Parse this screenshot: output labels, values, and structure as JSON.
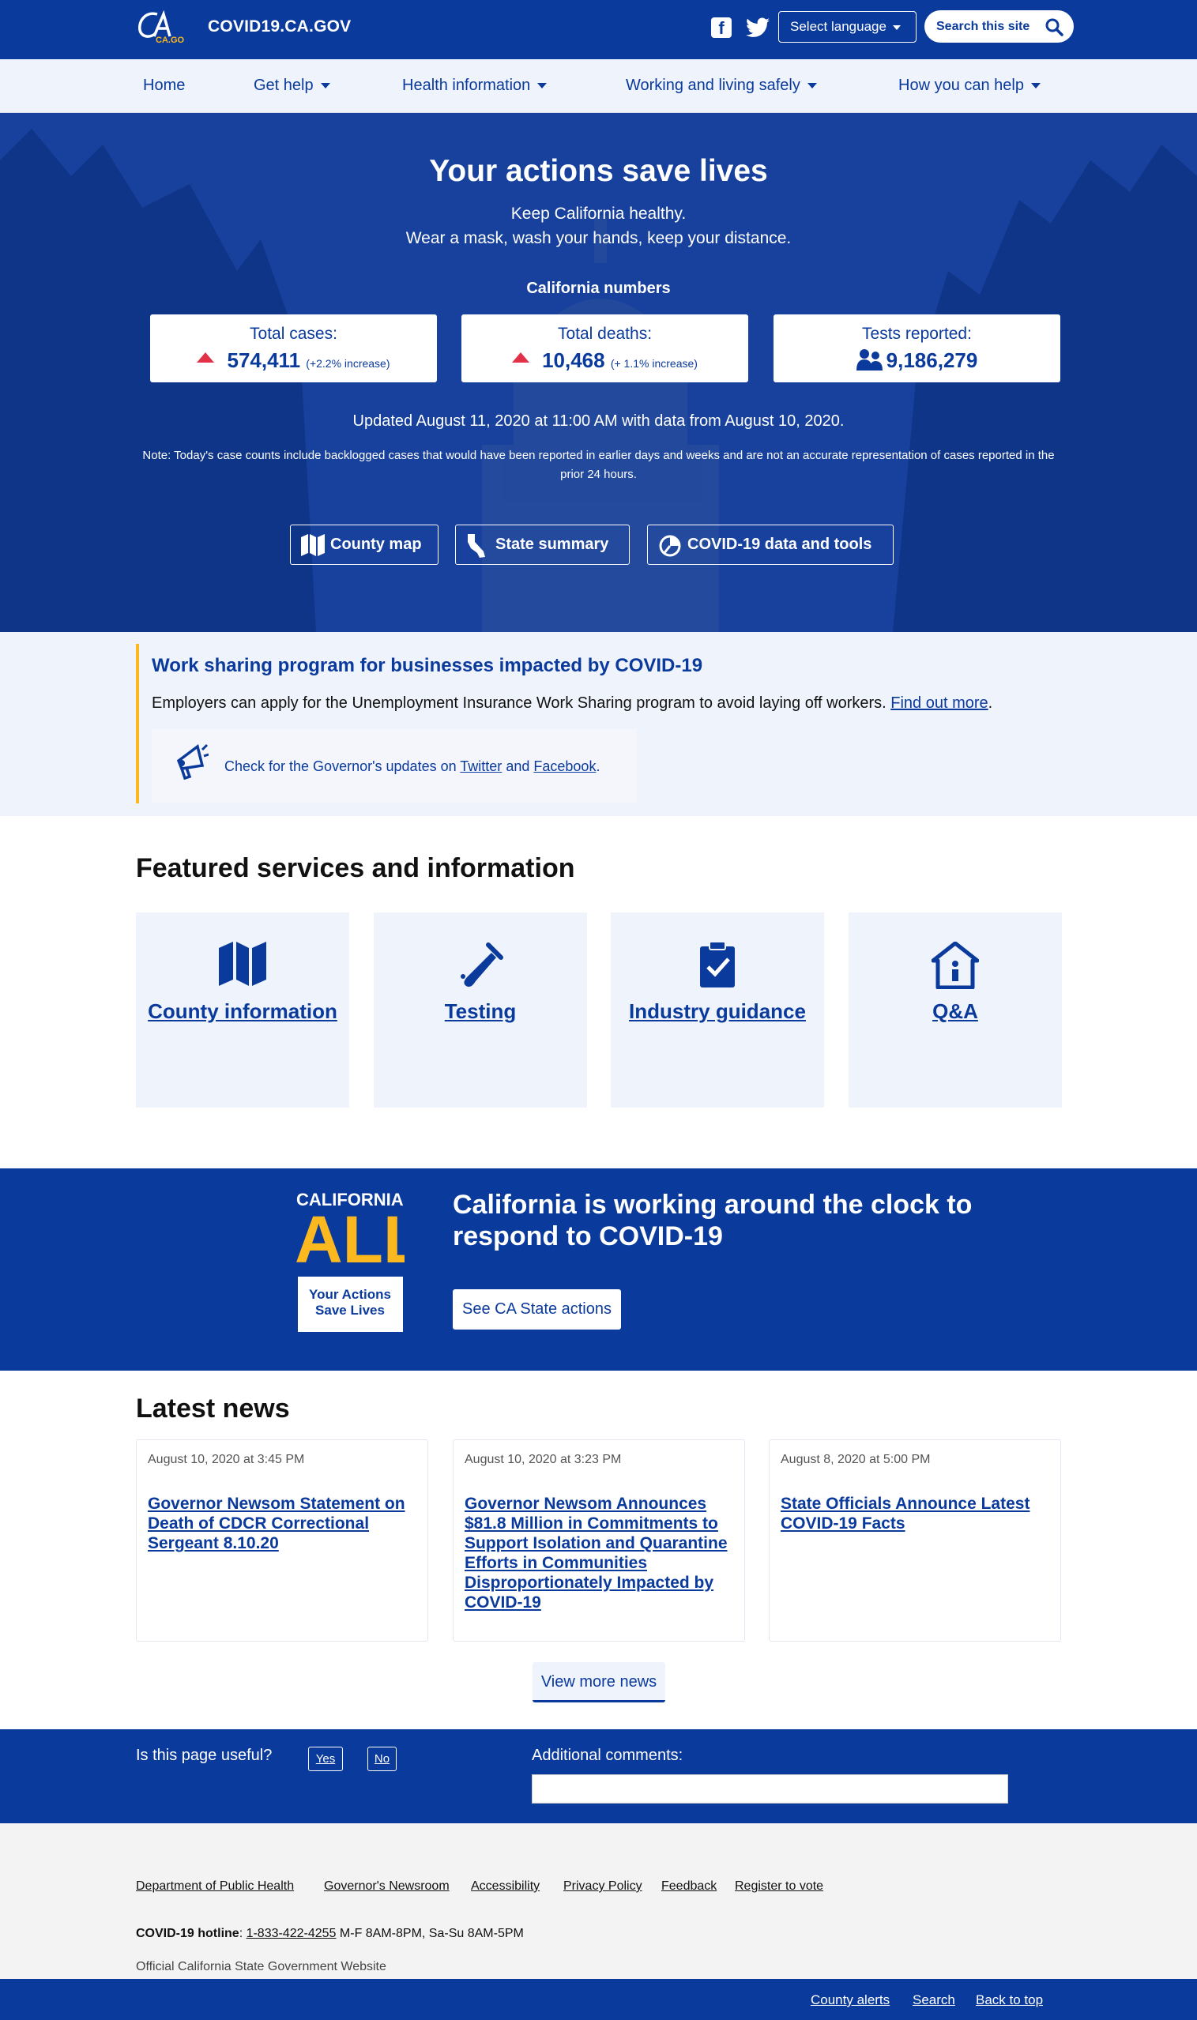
{
  "header": {
    "logo_text": "CA.GOV",
    "site_title": "COVID19.CA.GOV",
    "language_label": "Select language",
    "search_label": "Search this site"
  },
  "nav": {
    "items": [
      {
        "label": "Home"
      },
      {
        "label": "Get help"
      },
      {
        "label": "Health information"
      },
      {
        "label": "Working and living safely"
      },
      {
        "label": "How you can help"
      }
    ]
  },
  "hero": {
    "title": "Your actions save lives",
    "sub1": "Keep California healthy.",
    "sub2": "Wear a mask, wash your hands, keep your distance.",
    "numbers_heading": "California numbers",
    "stats": [
      {
        "label": "Total cases:",
        "value": "574,411",
        "change": "(+2.2% increase)"
      },
      {
        "label": "Total deaths:",
        "value": "10,468",
        "change": "(+ 1.1% increase)"
      },
      {
        "label": "Tests reported:",
        "value": "9,186,279"
      }
    ],
    "updated": "Updated August 11, 2020 at 11:00 AM with data from August 10, 2020.",
    "note": "Note: Today's case counts include backlogged cases that would have been reported in earlier days and weeks and are not an accurate representation of cases reported in the prior 24 hours.",
    "buttons": [
      {
        "label": "County map",
        "icon": "map-icon"
      },
      {
        "label": "State summary",
        "icon": "california-icon"
      },
      {
        "label": "COVID-19 data and tools",
        "icon": "pie-chart-icon"
      }
    ]
  },
  "alert": {
    "title": "Work sharing program for businesses impacted by COVID-19",
    "text": "Employers can apply for the Unemployment Insurance Work Sharing program to avoid laying off workers.",
    "link": "Find out more",
    "gov_prefix": "Check for the Governor's updates on",
    "gov_twitter": "Twitter",
    "gov_and": "and",
    "gov_facebook": "Facebook",
    "gov_suffix": "."
  },
  "featured": {
    "title": "Featured services and information",
    "cards": [
      {
        "label": "County information",
        "icon": "map-icon"
      },
      {
        "label": "Testing",
        "icon": "test-tube-icon"
      },
      {
        "label": "Industry guidance",
        "icon": "clipboard-check-icon"
      },
      {
        "label": "Q&A",
        "icon": "house-info-icon"
      }
    ]
  },
  "ca_all": {
    "logo_top": "CALIFORNIA",
    "logo_all": "ALL",
    "logo_tag1": "Your Actions",
    "logo_tag2": "Save Lives",
    "title": "California is working around the clock to respond to COVID-19",
    "button": "See CA State actions"
  },
  "news": {
    "title": "Latest news",
    "items": [
      {
        "date": "August 10, 2020 at 3:45 PM",
        "headline": "Governor Newsom Statement on Death of CDCR Correctional Sergeant 8.10.20"
      },
      {
        "date": "August 10, 2020 at 3:23 PM",
        "headline": "Governor Newsom Announces $81.8 Million in Commitments to Support Isolation and Quarantine Efforts in Communities Disproportionately Impacted by COVID-19"
      },
      {
        "date": "August 8, 2020 at 5:00 PM",
        "headline": "State Officials Announce Latest COVID-19 Facts"
      }
    ],
    "more": "View more news"
  },
  "feedback": {
    "question": "Is this page useful?",
    "yes": "Yes",
    "no": "No",
    "comments_label": "Additional comments:"
  },
  "footer": {
    "links": [
      "Department of Public Health",
      "Governor's Newsroom",
      "Accessibility",
      "Privacy Policy",
      "Feedback",
      "Register to vote"
    ],
    "hotline_label": "COVID-19 hotline",
    "hotline_number": "1-833-422-4255",
    "hotline_hours": "M-F 8AM-8PM, Sa-Su 8AM-5PM",
    "official": "Official California State Government Website",
    "bottom_links": [
      "County alerts",
      "Search",
      "Back to top"
    ]
  },
  "colors": {
    "brand_blue": "#0a3a9c",
    "accent_gold": "#fbb81f",
    "alert_red": "#e03148"
  }
}
